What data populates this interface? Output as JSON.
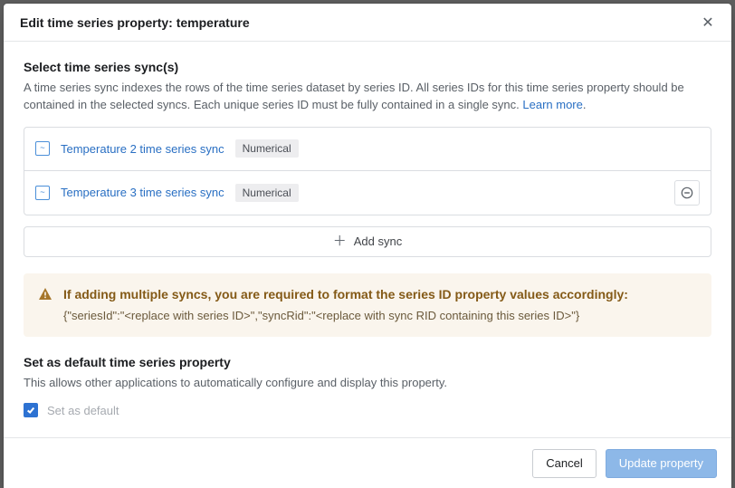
{
  "header": {
    "title": "Edit time series property: temperature"
  },
  "select_section": {
    "title": "Select time series sync(s)",
    "desc_prefix": "A time series sync indexes the rows of the time series dataset by series ID. All series IDs for this time series property should be contained in the selected syncs. Each unique series ID must be fully contained in a single sync. ",
    "learn_more": "Learn more"
  },
  "syncs": [
    {
      "name": "Temperature 2 time series sync",
      "type": "Numerical",
      "removable": false
    },
    {
      "name": "Temperature 3 time series sync",
      "type": "Numerical",
      "removable": true
    }
  ],
  "add_sync_label": "Add sync",
  "warning": {
    "title": "If adding multiple syncs, you are required to format the series ID property values accordingly:",
    "code": "{\"seriesId\":\"<replace with series ID>\",\"syncRid\":\"<replace with sync RID containing this series ID>\"}"
  },
  "default_section": {
    "title": "Set as default time series property",
    "desc": "This allows other applications to automatically configure and display this property.",
    "checkbox_label": "Set as default",
    "checked": true
  },
  "footer": {
    "cancel": "Cancel",
    "update": "Update property"
  }
}
